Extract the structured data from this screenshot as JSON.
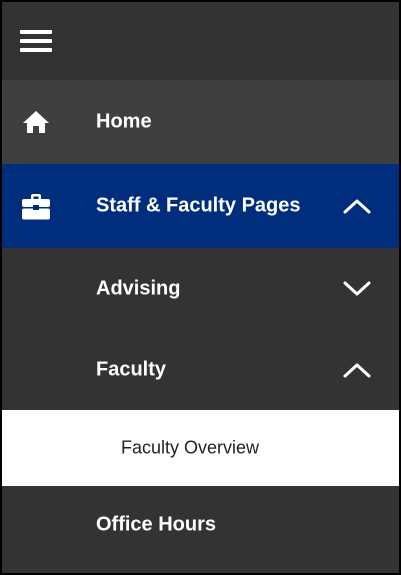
{
  "nav": {
    "menu_icon": "hamburger-menu-icon",
    "items": [
      {
        "label": "Home",
        "icon": "home-icon"
      },
      {
        "label": "Staff & Faculty Pages",
        "icon": "briefcase-icon",
        "expanded": true,
        "active": true
      },
      {
        "label": "Advising",
        "expanded": false
      },
      {
        "label": "Faculty",
        "expanded": true
      },
      {
        "label": "Faculty Overview",
        "selected": true
      },
      {
        "label": "Office Hours"
      }
    ]
  },
  "colors": {
    "background": "#333333",
    "home_row": "#3f3f3f",
    "active_row": "#002e7d",
    "selected_row": "#ffffff",
    "text": "#ffffff",
    "selected_text": "#222222"
  }
}
